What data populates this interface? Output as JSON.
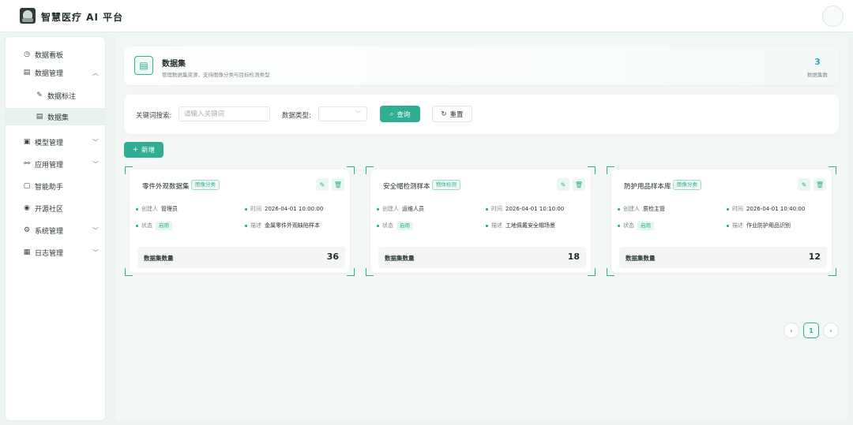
{
  "app": {
    "title": "智慧医疗 AI 平台"
  },
  "sidebar": {
    "items": [
      {
        "label": "数据看板",
        "icon": "dashboard-icon"
      },
      {
        "label": "数据管理",
        "icon": "database-icon",
        "expanded": true
      },
      {
        "label": "数据标注",
        "icon": "pencil-icon"
      },
      {
        "label": "数据集",
        "icon": "list-icon",
        "active": true
      },
      {
        "label": "模型管理",
        "icon": "model-icon"
      },
      {
        "label": "应用管理",
        "icon": "share-icon"
      },
      {
        "label": "智能助手",
        "icon": "assistant-icon"
      },
      {
        "label": "开源社区",
        "icon": "globe-icon"
      },
      {
        "label": "系统管理",
        "icon": "settings-icon"
      },
      {
        "label": "日志管理",
        "icon": "calendar-icon"
      }
    ]
  },
  "header": {
    "title": "数据集",
    "subtitle": "管理数据集资源，支持图像分类与目标检测类型",
    "count": "3",
    "count_label": "数据集数"
  },
  "filter": {
    "keyword_label": "关键词搜索:",
    "keyword_placeholder": "请输入关键词",
    "keyword_value": "",
    "type_label": "数据类型:",
    "type_value": "",
    "search_button": "查询",
    "reset_button": "重置"
  },
  "add_button": "新增",
  "meta_labels": {
    "creator": "创建人",
    "time": "时间",
    "status": "状态",
    "desc": "描述",
    "count": "数据集数量"
  },
  "datasets": [
    {
      "name": "零件外观数据集",
      "type": "图像分类",
      "creator": "管理员",
      "time": "2026-04-01 10:00:00",
      "status": "启用",
      "desc": "金属零件外观缺陷样本",
      "count": "36"
    },
    {
      "name": "安全帽检测样本",
      "type": "物体检测",
      "creator": "运维人员",
      "time": "2026-04-01 10:10:00",
      "status": "启用",
      "desc": "工地佩戴安全帽场景",
      "count": "18"
    },
    {
      "name": "防护用品样本库",
      "type": "图像分类",
      "creator": "质检主管",
      "time": "2026-04-01 10:40:00",
      "status": "启用",
      "desc": "作业防护用品识别",
      "count": "12"
    }
  ],
  "pagination": {
    "prev": "‹",
    "current": "1",
    "next": "›"
  },
  "colors": {
    "accent": "#2fae94",
    "count_accent": "#2fa3c7",
    "background": "#eef5f3"
  }
}
